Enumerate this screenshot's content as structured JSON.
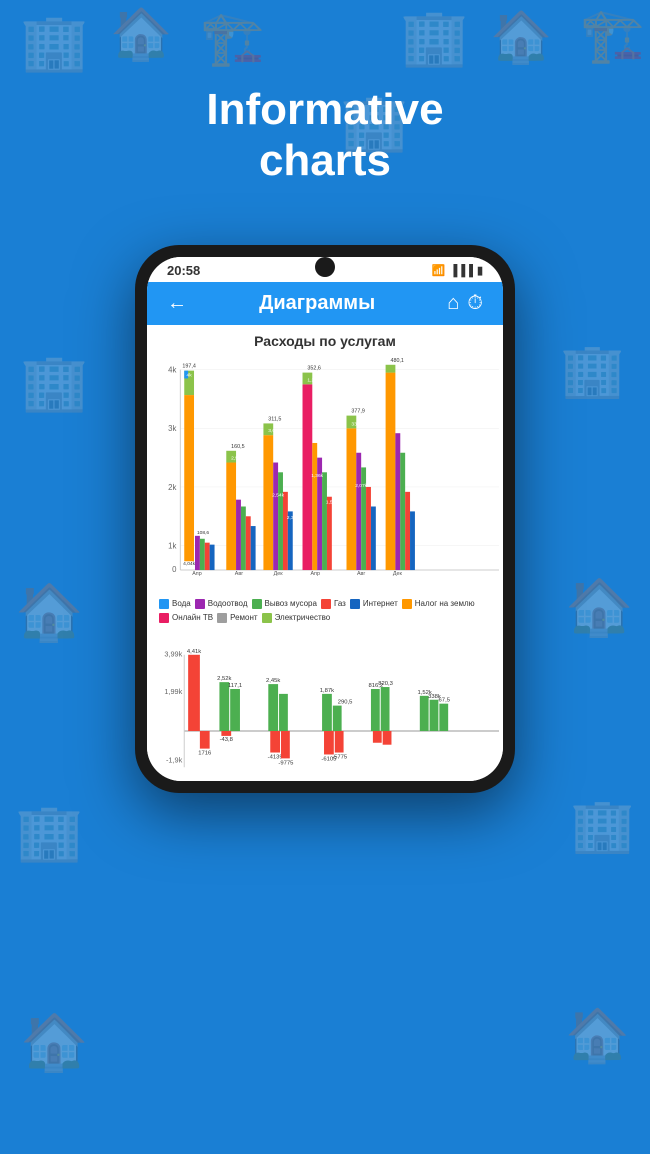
{
  "background": {
    "color": "#1a7fd4"
  },
  "header": {
    "line1": "Informative",
    "line2": "charts"
  },
  "phone": {
    "status_bar": {
      "time": "20:58",
      "icons": "WiFi Signal Battery"
    },
    "app_bar": {
      "title": "Диаграммы",
      "back_label": "←",
      "home_icon": "🏠",
      "clock_icon": "🕐"
    },
    "main_chart": {
      "title": "Расходы по услугам",
      "y_labels": [
        "4k",
        "3k",
        "2k",
        "1k",
        "0"
      ],
      "x_labels": [
        "Апр",
        "Авг",
        "Дек",
        "Апр",
        "Авг",
        "Дек"
      ],
      "legend": [
        {
          "label": "Вода",
          "color": "#2196F3"
        },
        {
          "label": "Водоотвод",
          "color": "#9C27B0"
        },
        {
          "label": "Вывоз мусора",
          "color": "#4CAF50"
        },
        {
          "label": "Газ",
          "color": "#F44336"
        },
        {
          "label": "Интернет",
          "color": "#1565C0"
        },
        {
          "label": "Налог на землю",
          "color": "#FF9800"
        },
        {
          "label": "Онлайн ТВ",
          "color": "#E91E63"
        },
        {
          "label": "Ремонт",
          "color": "#9E9E9E"
        },
        {
          "label": "Электричество",
          "color": "#8BC34A"
        }
      ]
    },
    "second_chart": {
      "values_pos": [
        "4,41k",
        "2,52k",
        "2,45k",
        "1,87k",
        "1,52k"
      ],
      "values_neg": [
        "-43,8",
        "-4139",
        "-9775",
        "-6105",
        "-5775"
      ],
      "bar_labels_pos": [
        "3,99k",
        "1,99k"
      ],
      "y_labels": [
        "3,99k",
        "1,99k",
        "-1,9k"
      ]
    }
  }
}
